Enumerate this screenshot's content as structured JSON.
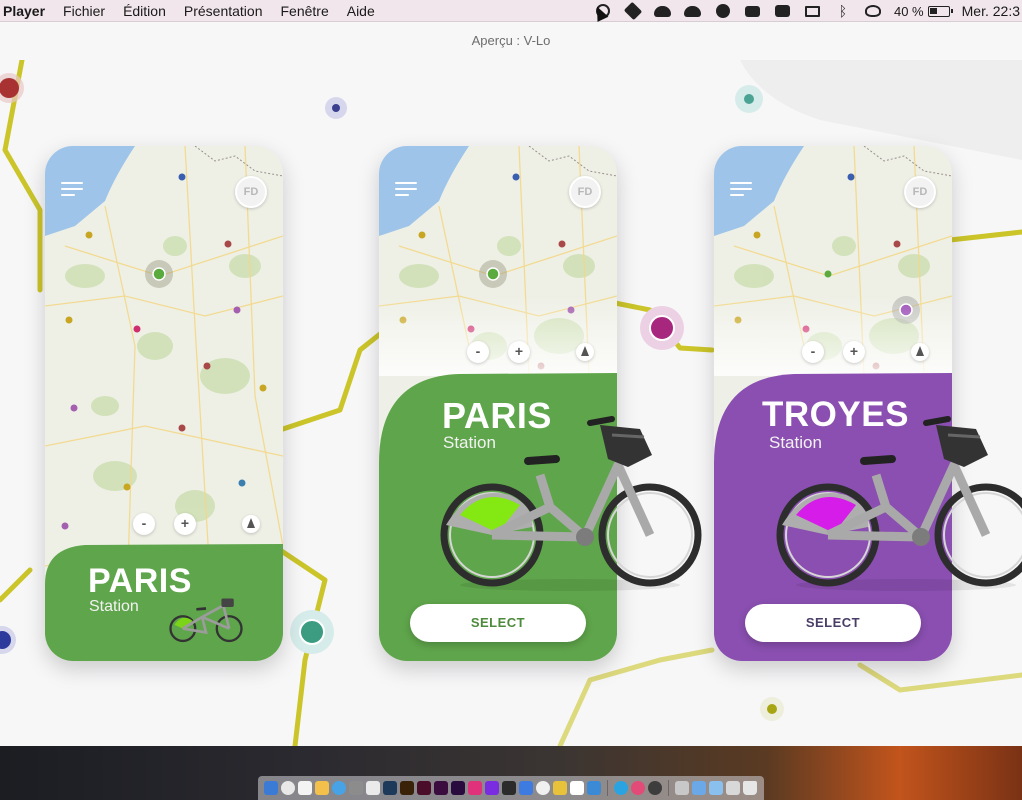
{
  "menubar": {
    "app": "Player",
    "items": [
      "Fichier",
      "Édition",
      "Présentation",
      "Fenêtre",
      "Aide"
    ],
    "battery": "40 %",
    "clock": "Mer. 22:3"
  },
  "window": {
    "title": "Aperçu : V-Lo"
  },
  "colors": {
    "green": "#5fa54b",
    "purple": "#8a4fb0",
    "route_yellow": "#c8c21f",
    "select_text_green": "#4e8a3c",
    "select_text_purple": "#4a3d66"
  },
  "cards": [
    {
      "avatar": "FD",
      "zoom_out": "-",
      "zoom_in": "+",
      "city": "PARIS",
      "subtitle": "Station"
    },
    {
      "avatar": "FD",
      "zoom_out": "-",
      "zoom_in": "+",
      "city": "PARIS",
      "subtitle": "Station",
      "button": "SELECT"
    },
    {
      "avatar": "FD",
      "zoom_out": "-",
      "zoom_in": "+",
      "city": "TROYES",
      "subtitle": "Station",
      "button": "SELECT"
    }
  ],
  "icons": {
    "hamburger": "hamburger-icon",
    "compass": "compass-icon",
    "bike": "bicycle-illustration"
  }
}
